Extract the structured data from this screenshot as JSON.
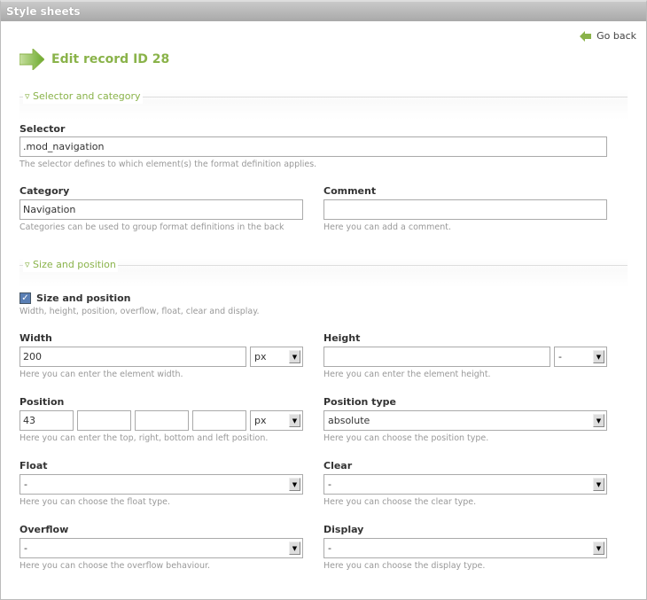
{
  "header": {
    "title": "Style sheets"
  },
  "go_back": "Go back",
  "page_title": "Edit record ID 28",
  "sections": [
    {
      "legend": "Selector and category"
    },
    {
      "legend": "Size and position"
    }
  ],
  "selector": {
    "label": "Selector",
    "value": ".mod_navigation",
    "help": "The selector defines to which element(s) the format definition applies."
  },
  "category": {
    "label": "Category",
    "value": "Navigation",
    "help": "Categories can be used to group format definitions in the back"
  },
  "comment": {
    "label": "Comment",
    "value": "",
    "help": "Here you can add a comment."
  },
  "size_position": {
    "label": "Size and position",
    "checked": true,
    "help": "Width, height, position, overflow, float, clear and display."
  },
  "width": {
    "label": "Width",
    "value": "200",
    "unit": "px",
    "help": "Here you can enter the element width."
  },
  "height": {
    "label": "Height",
    "value": "",
    "unit": "-",
    "help": "Here you can enter the element height."
  },
  "position": {
    "label": "Position",
    "top": "43",
    "right": "",
    "bottom": "",
    "left": "",
    "unit": "px",
    "help": "Here you can enter the top, right, bottom and left position."
  },
  "position_type": {
    "label": "Position type",
    "value": "absolute",
    "help": "Here you can choose the position type."
  },
  "float": {
    "label": "Float",
    "value": "-",
    "help": "Here you can choose the float type."
  },
  "clear": {
    "label": "Clear",
    "value": "-",
    "help": "Here you can choose the clear type."
  },
  "overflow": {
    "label": "Overflow",
    "value": "-",
    "help": "Here you can choose the overflow behaviour."
  },
  "display": {
    "label": "Display",
    "value": "-",
    "help": "Here you can choose the display type."
  },
  "colors": {
    "accent": "#8ab34a",
    "header": "#b0b0b0"
  }
}
